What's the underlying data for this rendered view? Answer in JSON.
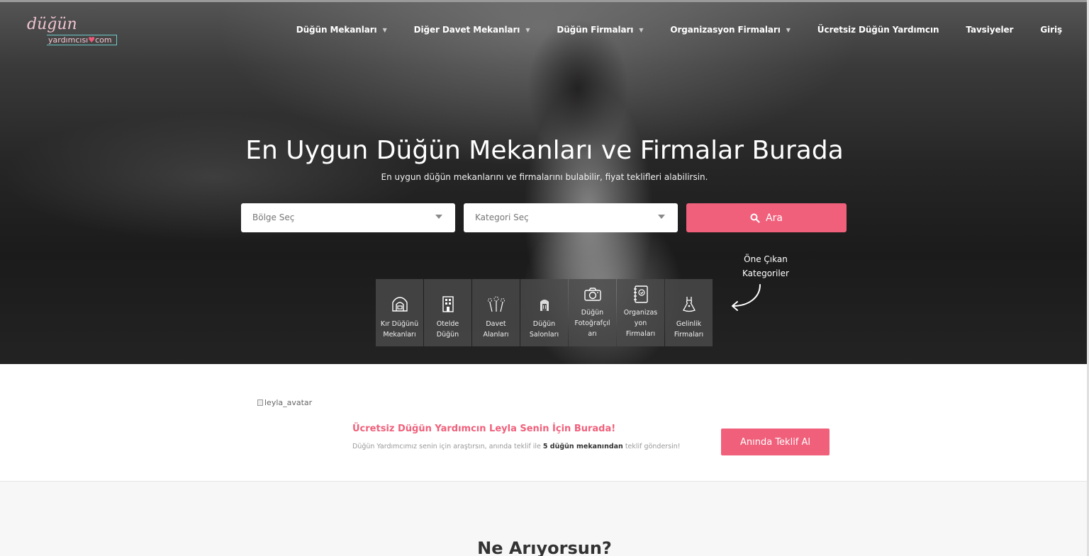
{
  "logo": {
    "line1": "düğün",
    "line2": "yardımcısı",
    "heart": "♥",
    "tld": "com"
  },
  "nav": [
    {
      "label": "Düğün Mekanları",
      "dropdown": true
    },
    {
      "label": "Diğer Davet Mekanları",
      "dropdown": true
    },
    {
      "label": "Düğün Firmaları",
      "dropdown": true
    },
    {
      "label": "Organizasyon Firmaları",
      "dropdown": true
    },
    {
      "label": "Ücretsiz Düğün Yardımcın",
      "dropdown": false
    },
    {
      "label": "Tavsiyeler",
      "dropdown": false
    },
    {
      "label": "Giriş",
      "dropdown": false
    }
  ],
  "hero": {
    "title": "En Uygun Düğün Mekanları ve Firmalar Burada",
    "subtitle": "En uygun düğün mekanlarını ve firmalarını bulabilir, fiyat teklifleri alabilirsin."
  },
  "search": {
    "region_placeholder": "Bölge Seç",
    "category_placeholder": "Kategori Seç",
    "button_label": "Ara"
  },
  "featured": {
    "label_line1": "Öne Çıkan",
    "label_line2": "Kategoriler",
    "categories": [
      {
        "lines": [
          "Kır Düğünü",
          "Mekanları"
        ],
        "icon": "tent-icon"
      },
      {
        "lines": [
          "Otelde",
          "Düğün"
        ],
        "icon": "hotel-icon"
      },
      {
        "lines": [
          "Davet",
          "Alanları"
        ],
        "icon": "fireworks-icon"
      },
      {
        "lines": [
          "Düğün",
          "Salonları"
        ],
        "icon": "hall-icon"
      },
      {
        "lines": [
          "Düğün",
          "Fotoğrafçıl",
          "arı"
        ],
        "icon": "camera-icon"
      },
      {
        "lines": [
          "Organizas",
          "yon",
          "Firmaları"
        ],
        "icon": "planner-icon"
      },
      {
        "lines": [
          "Gelinlik",
          "Firmaları"
        ],
        "icon": "dress-icon"
      }
    ]
  },
  "banner": {
    "avatar_alt": "leyla_avatar",
    "title": "Ücretsiz Düğün Yardımcın Leyla Senin İçin Burada!",
    "desc_before": "Düğün Yardımcımız senin için araştırsın, anında teklif ile ",
    "desc_bold": "5 düğün mekanından",
    "desc_after": " teklif göndersin!",
    "button_label": "Anında Teklif Al"
  },
  "section": {
    "title": "Ne Arıyorsun?"
  },
  "colors": {
    "accent": "#f0607b",
    "hero_dark": "#1f1f1f",
    "tile_bg": "#4b4b4b"
  }
}
